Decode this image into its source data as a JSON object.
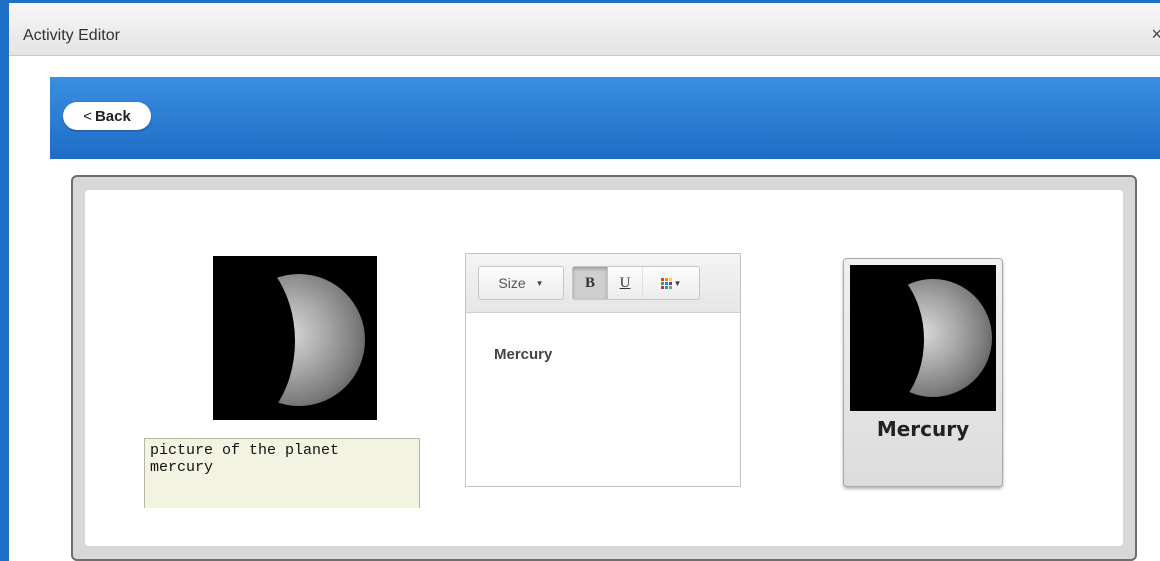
{
  "window": {
    "title": "Activity Editor",
    "close_glyph": "×"
  },
  "header": {
    "back_label": "Back",
    "back_chevron": "<"
  },
  "left": {
    "image_icon": "mercury-planet-image",
    "caption_value": "picture of the planet\nmercury"
  },
  "editor": {
    "toolbar": {
      "size_label": "Size",
      "bold_label": "B",
      "underline_label": "U",
      "bold_active": true
    },
    "content": "Mercury"
  },
  "card": {
    "label": "Mercury"
  },
  "colors": {
    "frame_blue": "#1c6fc4",
    "header_blue": "#2f80d8"
  }
}
